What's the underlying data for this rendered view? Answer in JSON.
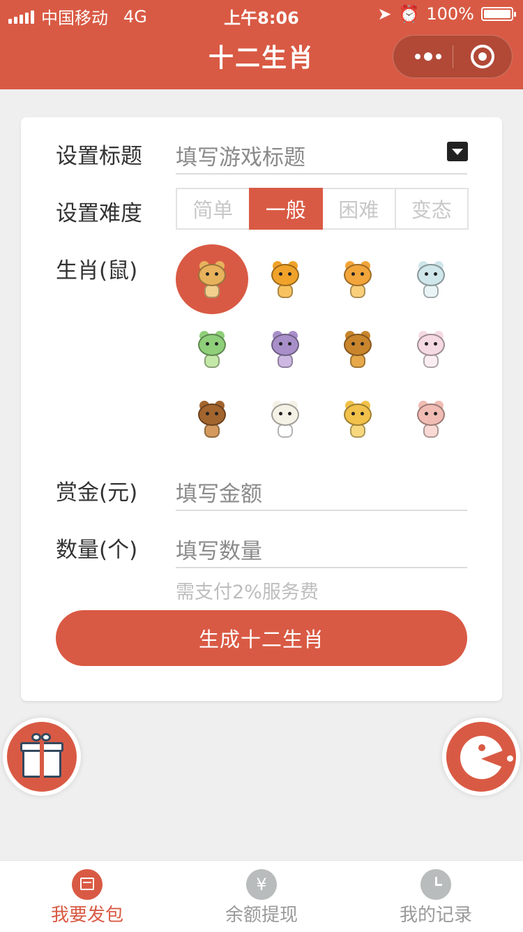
{
  "status_bar": {
    "carrier": "中国移动",
    "network": "4G",
    "time": "上午8:06",
    "battery": "100%",
    "battery_level": 1.0
  },
  "nav": {
    "title": "十二生肖"
  },
  "form": {
    "title_label": "设置标题",
    "title_placeholder": "填写游戏标题",
    "difficulty_label": "设置难度",
    "difficulty_options": [
      "简单",
      "一般",
      "困难",
      "变态"
    ],
    "difficulty_selected": "一般",
    "zodiac_label": "生肖(鼠)",
    "zodiac_icons": [
      "rat-icon",
      "ox-icon",
      "tiger-icon",
      "rabbit-icon",
      "dragon-icon",
      "snake-icon",
      "horse-icon",
      "sheep-icon",
      "monkey-icon",
      "rooster-icon",
      "dog-icon",
      "pig-icon"
    ],
    "zodiac_selected_index": 0,
    "reward_label": "赏金(元)",
    "reward_placeholder": "填写金额",
    "count_label": "数量(个)",
    "count_placeholder": "填写数量",
    "fee_hint": "需支付2%服务费",
    "submit_label": "生成十二生肖"
  },
  "colors": {
    "accent": "#d95a44",
    "background": "#efefef"
  },
  "tabbar": {
    "items": [
      {
        "label": "我要发包",
        "icon": "calendar-icon",
        "active": true
      },
      {
        "label": "余额提现",
        "icon": "yen-icon",
        "active": false
      },
      {
        "label": "我的记录",
        "icon": "clock-icon",
        "active": false
      }
    ],
    "yen_glyph": "¥"
  }
}
